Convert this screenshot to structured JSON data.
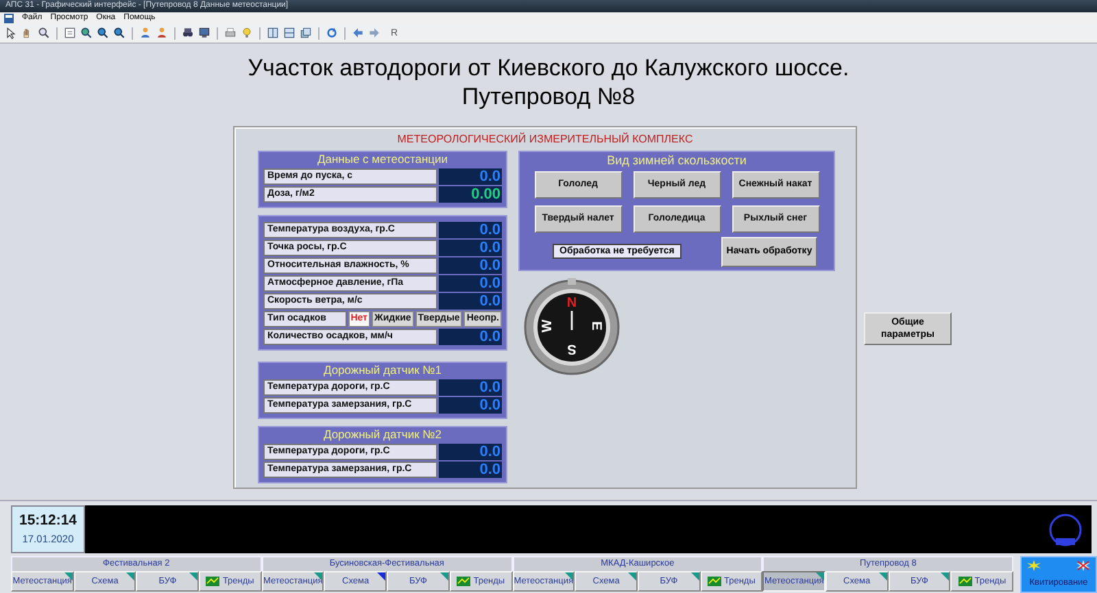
{
  "window": {
    "title": "АПС 31 - Графический интерфейс - [Путепровод 8 Данные метеостанции]"
  },
  "menu": [
    "Файл",
    "Просмотр",
    "Окна",
    "Помощь"
  ],
  "toolbar": {
    "text_button": "R"
  },
  "heading": [
    "Участок автодороги от Киевского до Калужского шоссе.",
    "Путепровод №8"
  ],
  "panel": {
    "title": "МЕТЕОРОЛОГИЧЕСКИЙ ИЗМЕРИТЕЛЬНЫЙ КОМПЛЕКС",
    "groups": [
      {
        "title": "Данные с метеостанции",
        "rows": [
          {
            "kind": "value",
            "label": "Время до пуска, с",
            "value": "0.0"
          },
          {
            "kind": "highlight",
            "label": "Доза, г/м2",
            "value": "0.00"
          }
        ]
      },
      {
        "rows": [
          {
            "kind": "value",
            "label": "Температура воздуха, гр.С",
            "value": "0.0"
          },
          {
            "kind": "value",
            "label": "Точка росы, гр.С",
            "value": "0.0"
          },
          {
            "kind": "value",
            "label": "Относительная влажность, %",
            "value": "0.0"
          },
          {
            "kind": "value",
            "label": "Атмосферное давление, гПа",
            "value": "0.0"
          },
          {
            "kind": "value",
            "label": "Скорость ветра, м/с",
            "value": "0.0"
          },
          {
            "kind": "choice",
            "label": "Тип осадков",
            "options": [
              {
                "label": "Нет",
                "selected": true
              },
              {
                "label": "Жидкие",
                "selected": false
              },
              {
                "label": "Твердые",
                "selected": false
              },
              {
                "label": "Неопр.",
                "selected": false
              }
            ]
          },
          {
            "kind": "value",
            "label": "Количество осадков, мм/ч",
            "value": "0.0"
          }
        ]
      },
      {
        "title": "Дорожный датчик №1",
        "rows": [
          {
            "kind": "value",
            "label": "Температура дороги, гр.С",
            "value": "0.0"
          },
          {
            "kind": "value",
            "label": "Температура замерзания, гр.С",
            "value": "0.0"
          }
        ]
      },
      {
        "title": "Дорожный датчик №2",
        "rows": [
          {
            "kind": "value",
            "label": "Температура дороги, гр.С",
            "value": "0.0"
          },
          {
            "kind": "value",
            "label": "Температура замерзания, гр.С",
            "value": "0.0"
          }
        ]
      }
    ],
    "slipperiness": {
      "title": "Вид зимней скользкости",
      "types": [
        "Гололед",
        "Черный лед",
        "Снежный накат",
        "Твердый налет",
        "Гололедица",
        "Рыхлый снег"
      ],
      "status": "Обработка не требуется",
      "action": "Начать обработку"
    },
    "compass": {
      "labels": [
        "N",
        "E",
        "S",
        "W"
      ]
    }
  },
  "general_button": "Общие параметры",
  "clock": {
    "time": "15:12:14",
    "date": "17.01.2020"
  },
  "stations": [
    {
      "name": "Фестивальная 2",
      "tabs": [
        {
          "kind": "tab",
          "label": "Метеостанция",
          "selected": false,
          "color": "#1a9a8a"
        },
        {
          "kind": "tab",
          "label": "Схема",
          "selected": false,
          "color": "#1a9a8a"
        },
        {
          "kind": "tab",
          "label": "БУФ",
          "selected": false,
          "color": "#1a9a8a"
        },
        {
          "kind": "trends",
          "label": "Тренды",
          "selected": false
        }
      ]
    },
    {
      "name": "Бусиновская-Фестивальная",
      "tabs": [
        {
          "kind": "tab",
          "label": "Метеостанция",
          "selected": false,
          "color": "#1a9a8a"
        },
        {
          "kind": "tab",
          "label": "Схема",
          "selected": false,
          "color": "#1a2adf"
        },
        {
          "kind": "tab",
          "label": "БУФ",
          "selected": false,
          "color": "#1a9a8a"
        },
        {
          "kind": "trends",
          "label": "Тренды",
          "selected": false
        }
      ]
    },
    {
      "name": "МКАД-Каширское",
      "tabs": [
        {
          "kind": "tab",
          "label": "Метеостанция",
          "selected": false,
          "color": "#1a9a8a"
        },
        {
          "kind": "tab",
          "label": "Схема",
          "selected": false,
          "color": "#1a9a8a"
        },
        {
          "kind": "tab",
          "label": "БУФ",
          "selected": false,
          "color": "#1a9a8a"
        },
        {
          "kind": "trends",
          "label": "Тренды",
          "selected": false
        }
      ]
    },
    {
      "name": "Путепровод 8",
      "tabs": [
        {
          "kind": "tab",
          "label": "Метеостанция",
          "selected": true,
          "color": "#1a9a8a"
        },
        {
          "kind": "tab",
          "label": "Схема",
          "selected": false,
          "color": "#1a9a8a"
        },
        {
          "kind": "tab",
          "label": "БУФ",
          "selected": false,
          "color": "#1a9a8a"
        },
        {
          "kind": "trends",
          "label": "Тренды",
          "selected": false
        }
      ]
    }
  ],
  "ack_button": "Квитирование"
}
